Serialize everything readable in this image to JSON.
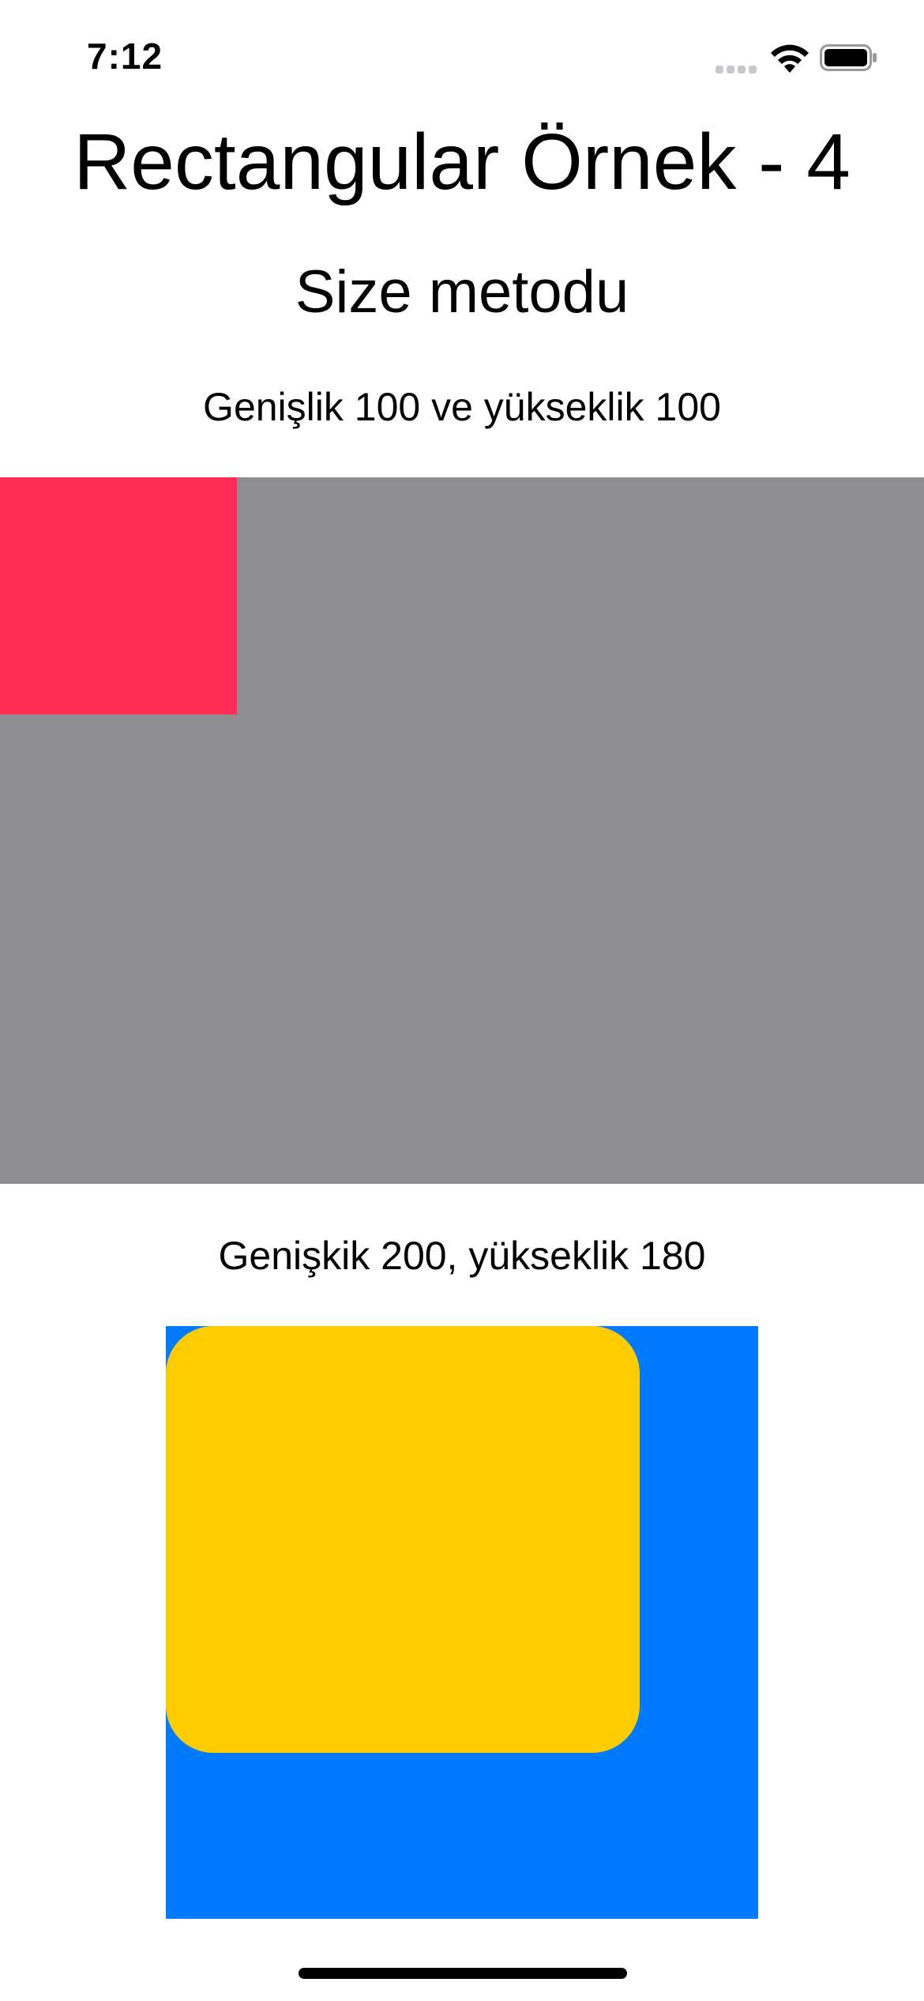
{
  "status_bar": {
    "time": "7:12",
    "icons": [
      "signal-icon",
      "wifi-icon",
      "battery-icon"
    ]
  },
  "title": "Rectangular Örnek - 4",
  "subtitle": "Size metodu",
  "example1": {
    "caption": "Genişlik 100 ve yükseklik 100"
  },
  "example2": {
    "caption": "Genişkik 200, yükseklik 180"
  },
  "colors": {
    "background": "#ffffff",
    "gray": "#8e8d92",
    "red": "#ff2d55",
    "blue": "#007aff",
    "yellow": "#ffcc00",
    "home_indicator": "#000000",
    "text": "#000000"
  }
}
